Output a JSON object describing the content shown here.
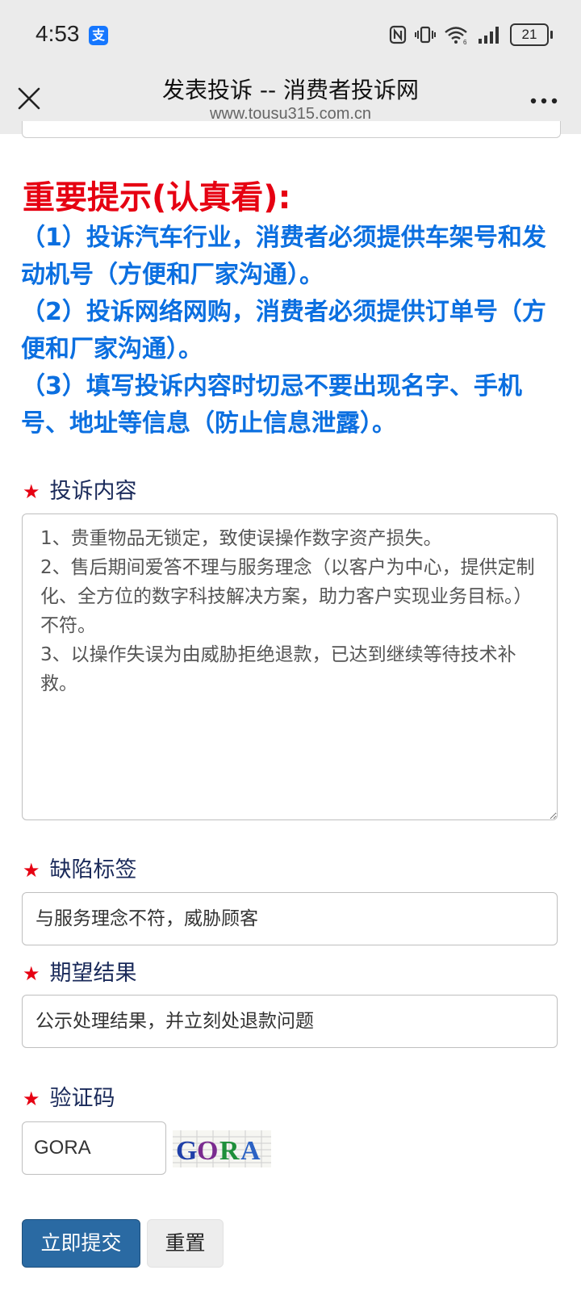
{
  "status_bar": {
    "time": "4:53",
    "alipay_glyph": "支",
    "battery": "21",
    "icons": [
      "nfc-icon",
      "vibrate-icon",
      "wifi-icon",
      "signal-icon",
      "battery-icon"
    ]
  },
  "browser": {
    "title": "发表投诉 -- 消费者投诉网",
    "url": "www.tousu315.com.cn"
  },
  "notice": {
    "title": "重要提示(认真看):",
    "items": [
      "（1）投诉汽车行业，消费者必须提供车架号和发动机号（方便和厂家沟通）。",
      "（2）投诉网络网购，消费者必须提供订单号（方便和厂家沟通）。",
      "（3）填写投诉内容时切忌不要出现名字、手机号、地址等信息（防止信息泄露）。"
    ]
  },
  "form": {
    "required_mark": "★",
    "content": {
      "label": "投诉内容",
      "value": "1、贵重物品无锁定，致使误操作数字资产损失。\n2、售后期间爱答不理与服务理念（以客户为中心，提供定制化、全方位的数字科技解决方案，助力客户实现业务目标。）不符。\n3、以操作失误为由威胁拒绝退款，已达到继续等待技术补救。"
    },
    "defect_tag": {
      "label": "缺陷标签",
      "value": "与服务理念不符，威胁顾客"
    },
    "expected_result": {
      "label": "期望结果",
      "value": "公示处理结果，并立刻处退款问题"
    },
    "captcha": {
      "label": "验证码",
      "value": "GORA",
      "image_text": "GORA",
      "image_colors": [
        "#1f3fa8",
        "#7a2b8f",
        "#1e8f3a",
        "#2b62c4"
      ]
    },
    "submit_label": "立即提交",
    "reset_label": "重置"
  },
  "colors": {
    "notice_title": "#e60012",
    "notice_text": "#0b6fe0",
    "label": "#1a2a5a",
    "submit_bg": "#2a6aa3"
  }
}
